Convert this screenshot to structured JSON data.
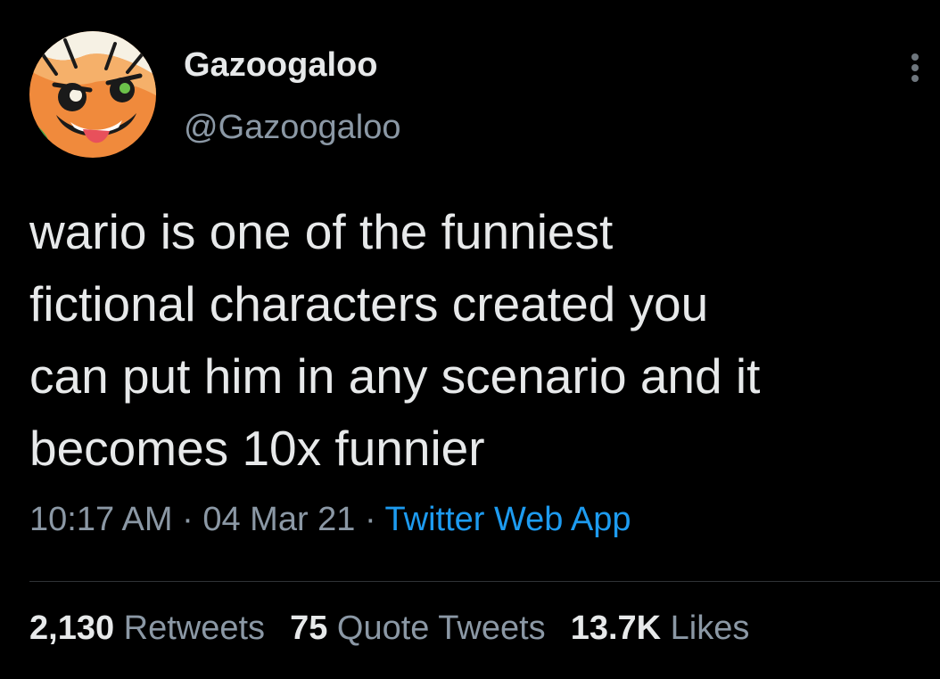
{
  "author": {
    "display_name": "Gazoogaloo",
    "handle": "@Gazoogaloo",
    "avatar_icon": "cartoon-face-avatar"
  },
  "tweet": {
    "text_lines": [
      "wario is one of the funniest",
      "fictional characters created you",
      "can put him in any scenario and it",
      "becomes 10x funnier"
    ],
    "time": "10:17 AM",
    "separator": "·",
    "date": "04 Mar 21",
    "source": "Twitter Web App"
  },
  "stats": {
    "retweets": {
      "count": "2,130",
      "label": "Retweets"
    },
    "quote_tweets": {
      "count": "75",
      "label": "Quote Tweets"
    },
    "likes": {
      "count": "13.7K",
      "label": "Likes"
    }
  },
  "icons": {
    "more": "more-vertical-icon"
  },
  "colors": {
    "background": "#000000",
    "primary_text": "#e7e9ea",
    "secondary_text": "#8b98a5",
    "link": "#1d9bf0",
    "divider": "#2f3336"
  }
}
